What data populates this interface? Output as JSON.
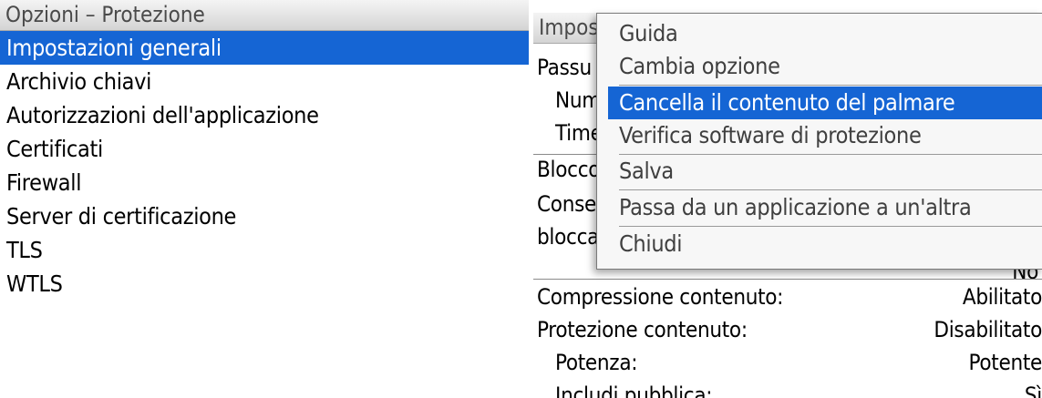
{
  "left": {
    "title": "Opzioni – Protezione",
    "items": [
      {
        "label": "Impostazioni generali",
        "selected": true
      },
      {
        "label": "Archivio chiavi",
        "selected": false
      },
      {
        "label": "Autorizzazioni dell'applicazione",
        "selected": false
      },
      {
        "label": "Certificati",
        "selected": false
      },
      {
        "label": "Firewall",
        "selected": false
      },
      {
        "label": "Server di certificazione",
        "selected": false
      },
      {
        "label": "TLS",
        "selected": false
      },
      {
        "label": "WTLS",
        "selected": false
      }
    ]
  },
  "right": {
    "title": "Impost",
    "partial_rows": {
      "passu": "Passu",
      "num": "Num",
      "time": "Time",
      "blocco": "Blocco",
      "conse": "Conse",
      "blocca": "blocca",
      "cut_value": "No"
    },
    "settings": [
      {
        "label": "Compressione contenuto:",
        "value": "Abilitato"
      },
      {
        "label": "Protezione contenuto:",
        "value": "Disabilitato"
      },
      {
        "label": "Potenza:",
        "value": "Potente"
      },
      {
        "label": "Includi pubblica:",
        "value": "Sì"
      }
    ]
  },
  "menu": {
    "items": [
      {
        "label": "Guida"
      },
      {
        "label": "Cambia opzione"
      },
      {
        "label": "Cancella il contenuto del palmare",
        "highlighted": true
      },
      {
        "label": "Verifica software di protezione"
      },
      {
        "label": "Salva"
      },
      {
        "label": "Passa da un applicazione a un'altra"
      },
      {
        "label": "Chiudi"
      }
    ]
  },
  "colors": {
    "selection": "#1565d4",
    "title_text": "#4a4a4a",
    "menu_text": "#3f3f3f",
    "menu_background": "#f7f7f7"
  }
}
